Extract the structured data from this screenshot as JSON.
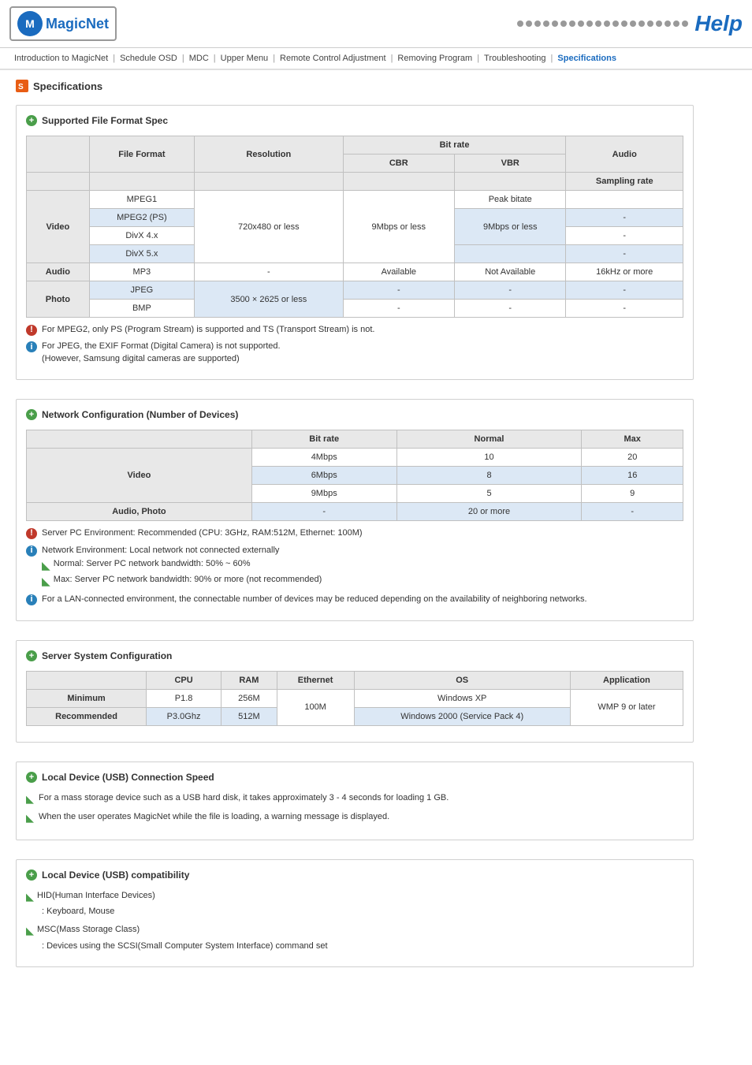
{
  "header": {
    "logo_text": "MagicNet",
    "help_text": "Help",
    "dots_count": 20
  },
  "nav": {
    "items": [
      {
        "label": "Introduction to MagicNet",
        "active": false
      },
      {
        "label": "Schedule OSD",
        "active": false
      },
      {
        "label": "MDC",
        "active": false
      },
      {
        "label": "Upper Menu",
        "active": false
      },
      {
        "label": "Remote Control Adjustment",
        "active": false
      },
      {
        "label": "Removing Program",
        "active": false
      },
      {
        "label": "Troubleshooting",
        "active": false
      },
      {
        "label": "Specifications",
        "active": true
      }
    ]
  },
  "page_title": "Specifications",
  "sections": {
    "file_format": {
      "title": "Supported File Format Spec",
      "table": {
        "headers_row1": [
          "",
          "File Format",
          "Resolution",
          "Bit rate",
          "",
          "Audio"
        ],
        "headers_row2": [
          "",
          "",
          "",
          "CBR",
          "VBR",
          "Sampling rate"
        ],
        "rows": [
          {
            "category": "Video",
            "formats": [
              "MPEG1",
              "MPEG2 (PS)",
              "DivX 4.x",
              "DivX 5.x"
            ],
            "resolution": "720x480 or less",
            "cbr": "9Mbps or less",
            "vbr_1": "Peak bitate",
            "vbr_2": "9Mbps or less",
            "sampling": "-"
          },
          {
            "category": "Audio",
            "formats": [
              "MP3"
            ],
            "resolution": "-",
            "cbr": "Available",
            "vbr": "Not Available",
            "sampling": "16kHz or more"
          },
          {
            "category": "Photo",
            "formats": [
              "JPEG",
              "BMP"
            ],
            "resolution": "3500 × 2625 or less",
            "cbr": "-",
            "vbr": "-",
            "sampling": "-"
          }
        ]
      },
      "notes": [
        {
          "type": "red",
          "text": "For MPEG2, only PS (Program Stream) is supported and TS (Transport Stream) is not."
        },
        {
          "type": "blue",
          "text": "For JPEG, the EXIF Format (Digital Camera) is not supported.\n(However, Samsung digital cameras are supported)"
        }
      ]
    },
    "network_config": {
      "title": "Network Configuration (Number of Devices)",
      "table": {
        "headers": [
          "",
          "Bit rate",
          "Normal",
          "Max"
        ],
        "rows": [
          {
            "category": "Video",
            "bitrate": "4Mbps",
            "normal": "10",
            "max": "20"
          },
          {
            "category": "Video",
            "bitrate": "6Mbps",
            "normal": "8",
            "max": "16"
          },
          {
            "category": "Video",
            "bitrate": "9Mbps",
            "normal": "5",
            "max": "9"
          },
          {
            "category": "Audio, Photo",
            "bitrate": "-",
            "normal": "20 or more",
            "max": "-"
          }
        ]
      },
      "notes": [
        {
          "type": "red",
          "text": "Server PC Environment: Recommended (CPU: 3GHz, RAM:512M, Ethernet: 100M)"
        },
        {
          "type": "blue",
          "text": "Network Environment: Local network not connected externally",
          "sub": [
            "Normal: Server PC network bandwidth: 50% ~ 60%",
            "Max: Server PC network bandwidth: 90% or more (not recommended)"
          ]
        },
        {
          "type": "blue",
          "text": "For a LAN-connected environment, the connectable number of devices may be reduced depending on the availability of neighboring networks."
        }
      ]
    },
    "server_system": {
      "title": "Server System Configuration",
      "table": {
        "headers": [
          "",
          "CPU",
          "RAM",
          "Ethernet",
          "OS",
          "Application"
        ],
        "rows": [
          {
            "category": "Minimum",
            "cpu": "P1.8",
            "ram": "256M",
            "ethernet": "100M",
            "os": "Windows XP",
            "app": "WMP 9 or later"
          },
          {
            "category": "Recommended",
            "cpu": "P3.0Ghz",
            "ram": "512M",
            "ethernet": "100M",
            "os": "Windows 2000 (Service Pack 4)",
            "app": "WMP 9 or later"
          }
        ]
      }
    },
    "local_device_speed": {
      "title": "Local Device (USB) Connection Speed",
      "notes": [
        {
          "type": "arrow",
          "text": "For a mass storage device such as a USB hard disk, it takes approximately 3 - 4 seconds for loading 1 GB."
        },
        {
          "type": "arrow",
          "text": "When the user operates MagicNet while the file is loading, a warning message is displayed."
        }
      ]
    },
    "local_device_compat": {
      "title": "Local Device (USB) compatibility",
      "items": [
        {
          "label": "HID(Human Interface Devices)",
          "sub": ": Keyboard, Mouse"
        },
        {
          "label": "MSC(Mass Storage Class)",
          "sub": ": Devices using the SCSI(Small Computer System Interface) command set"
        }
      ]
    }
  }
}
